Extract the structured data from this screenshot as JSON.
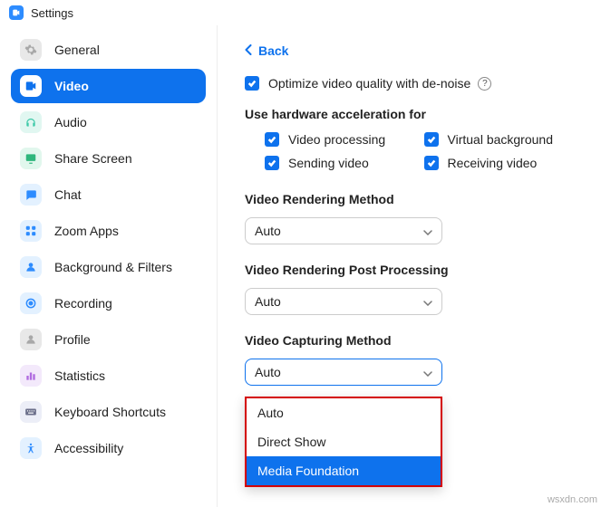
{
  "window": {
    "title": "Settings"
  },
  "sidebar": {
    "items": [
      {
        "label": "General"
      },
      {
        "label": "Video"
      },
      {
        "label": "Audio"
      },
      {
        "label": "Share Screen"
      },
      {
        "label": "Chat"
      },
      {
        "label": "Zoom Apps"
      },
      {
        "label": "Background & Filters"
      },
      {
        "label": "Recording"
      },
      {
        "label": "Profile"
      },
      {
        "label": "Statistics"
      },
      {
        "label": "Keyboard Shortcuts"
      },
      {
        "label": "Accessibility"
      }
    ]
  },
  "back": {
    "label": "Back"
  },
  "optimize": {
    "label": "Optimize video quality with de-noise"
  },
  "hw_accel": {
    "title": "Use hardware acceleration for",
    "video_processing": "Video processing",
    "virtual_background": "Virtual background",
    "sending_video": "Sending video",
    "receiving_video": "Receiving video"
  },
  "rendering_method": {
    "title": "Video Rendering Method",
    "value": "Auto"
  },
  "post_processing": {
    "title": "Video Rendering Post Processing",
    "value": "Auto"
  },
  "capturing": {
    "title": "Video Capturing Method",
    "value": "Auto",
    "options": [
      "Auto",
      "Direct Show",
      "Media Foundation"
    ]
  },
  "watermark": "wsxdn.com"
}
